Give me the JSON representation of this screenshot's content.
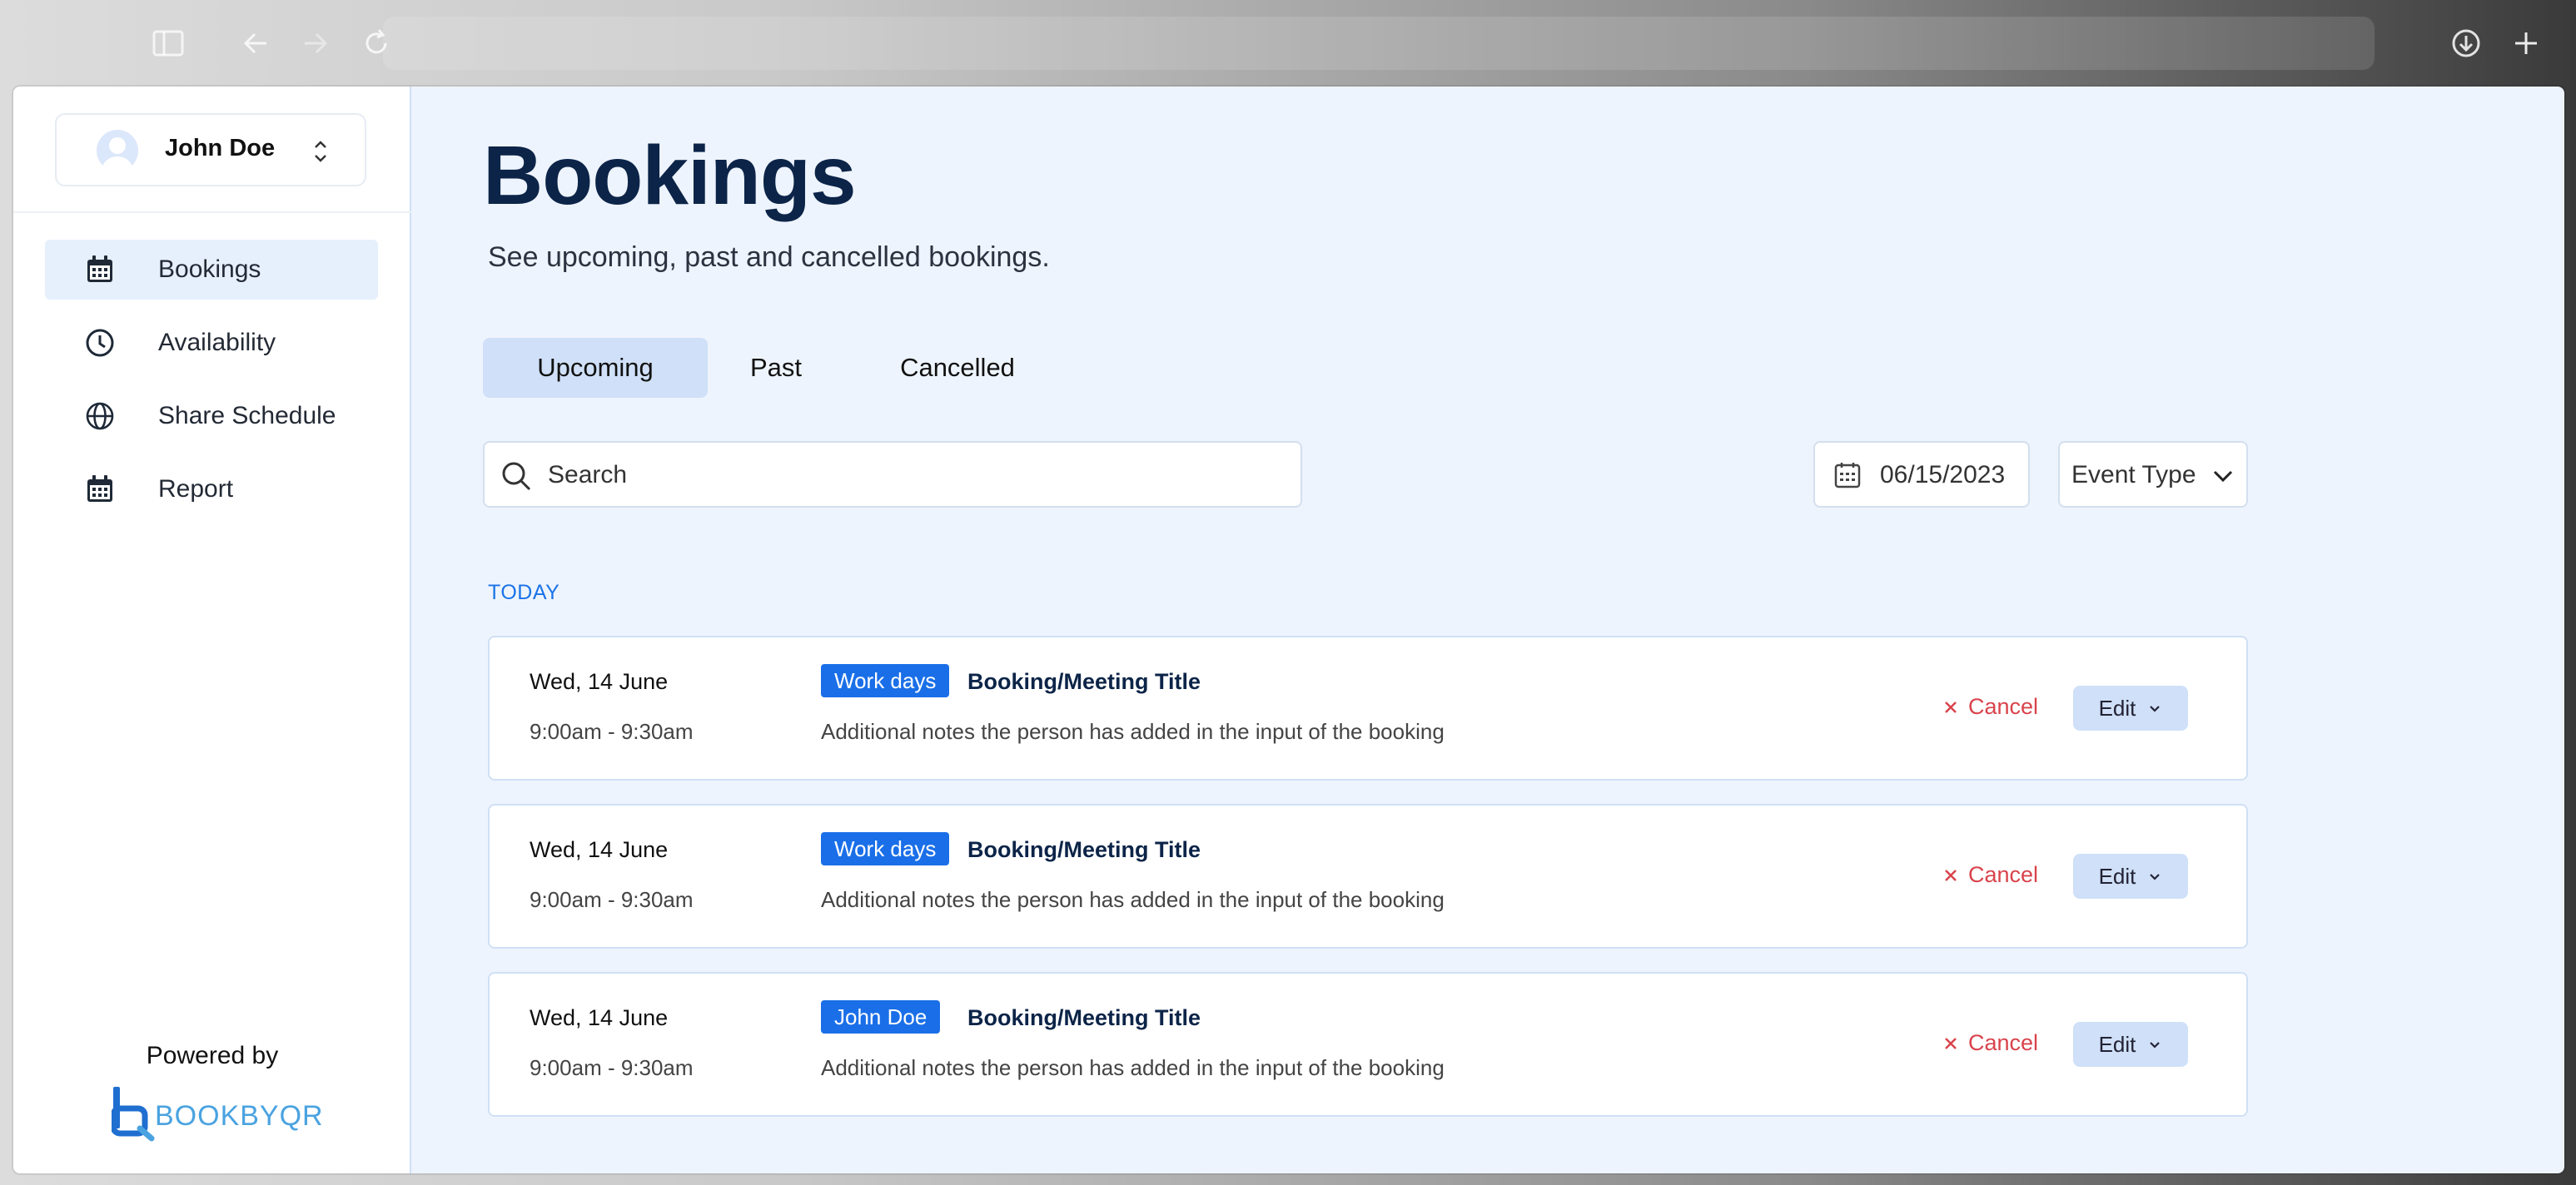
{
  "user": {
    "name": "John Doe"
  },
  "sidebar": {
    "items": [
      {
        "label": "Bookings",
        "icon": "calendar-icon",
        "active": true
      },
      {
        "label": "Availability",
        "icon": "clock-icon",
        "active": false
      },
      {
        "label": "Share Schedule",
        "icon": "globe-icon",
        "active": false
      },
      {
        "label": "Report",
        "icon": "calendar-icon",
        "active": false
      }
    ],
    "powered_by": "Powered by",
    "logo_text": "BOOKBYQR"
  },
  "page": {
    "title": "Bookings",
    "subtitle": "See upcoming, past and cancelled bookings."
  },
  "tabs": [
    {
      "label": "Upcoming",
      "active": true
    },
    {
      "label": "Past",
      "active": false
    },
    {
      "label": "Cancelled",
      "active": false
    }
  ],
  "filters": {
    "search_placeholder": "Search",
    "date": "06/15/2023",
    "event_type": "Event Type"
  },
  "section_label": "TODAY",
  "bookings": [
    {
      "date": "Wed, 14 June",
      "time": "9:00am - 9:30am",
      "tag": "Work days",
      "title": "Booking/Meeting Title",
      "notes": "Additional notes the person has added in the input of the booking",
      "cancel_label": "Cancel",
      "edit_label": "Edit"
    },
    {
      "date": "Wed, 14 June",
      "time": "9:00am - 9:30am",
      "tag": "Work days",
      "title": "Booking/Meeting Title",
      "notes": "Additional notes the person has added in the input of the booking",
      "cancel_label": "Cancel",
      "edit_label": "Edit"
    },
    {
      "date": "Wed, 14 June",
      "time": "9:00am - 9:30am",
      "tag": "John Doe",
      "title": "Booking/Meeting Title",
      "notes": "Additional notes the person has added in the input of the booking",
      "cancel_label": "Cancel",
      "edit_label": "Edit"
    }
  ],
  "colors": {
    "accent": "#1a6fe8",
    "cancel": "#d9434b",
    "title": "#0c2448",
    "active_bg": "#cfe0f8"
  }
}
